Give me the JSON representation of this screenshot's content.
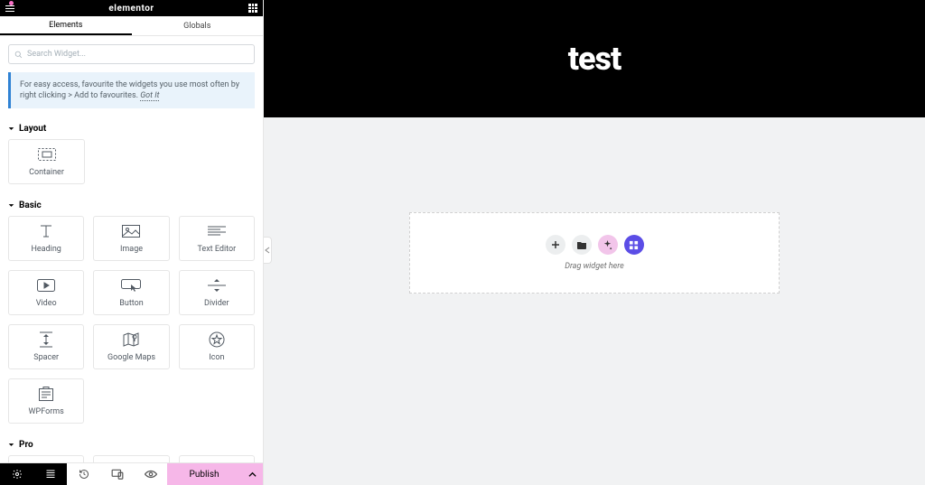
{
  "brand": "elementor",
  "tabs": {
    "elements": "Elements",
    "globals": "Globals"
  },
  "search": {
    "placeholder": "Search Widget..."
  },
  "hint": {
    "text": "For easy access, favourite the widgets you use most often by right clicking > Add to favourites. ",
    "link": "Got It"
  },
  "sections": {
    "layout": {
      "title": "Layout",
      "widgets": [
        "Container"
      ]
    },
    "basic": {
      "title": "Basic",
      "widgets": [
        "Heading",
        "Image",
        "Text Editor",
        "Video",
        "Button",
        "Divider",
        "Spacer",
        "Google Maps",
        "Icon",
        "WPForms"
      ]
    },
    "pro": {
      "title": "Pro"
    }
  },
  "bottom": {
    "publish": "Publish"
  },
  "canvas": {
    "title": "test",
    "drop_hint": "Drag widget here"
  }
}
